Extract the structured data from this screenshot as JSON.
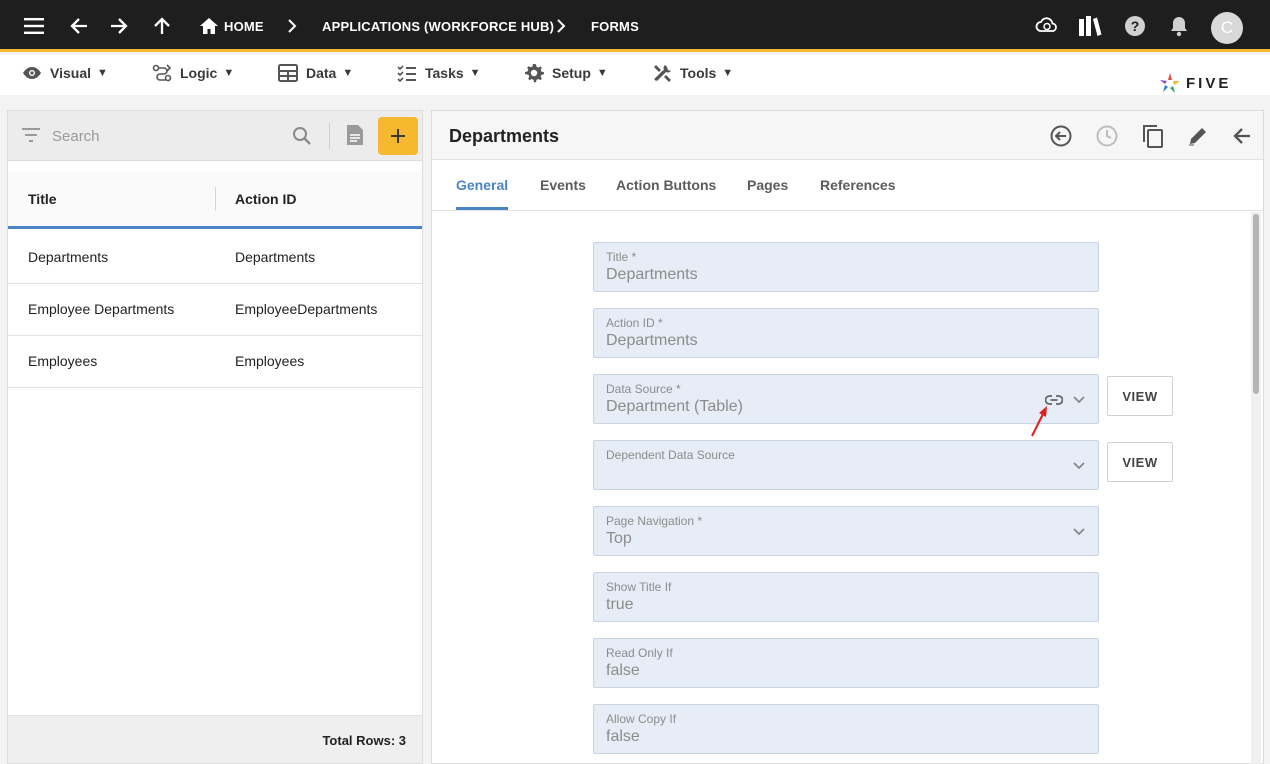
{
  "topbar": {
    "breadcrumbs": [
      "HOME",
      "APPLICATIONS (WORKFORCE HUB)",
      "FORMS"
    ],
    "avatar_letter": "C",
    "icons": [
      "menu-icon",
      "back-arrow-icon",
      "forward-arrow-icon",
      "up-arrow-icon",
      "home-icon",
      "cloud-sync-icon",
      "library-icon",
      "help-icon",
      "bell-icon"
    ]
  },
  "menubar": {
    "items": [
      {
        "label": "Visual",
        "icon": "eye-icon"
      },
      {
        "label": "Logic",
        "icon": "logic-icon"
      },
      {
        "label": "Data",
        "icon": "table-icon"
      },
      {
        "label": "Tasks",
        "icon": "tasks-icon"
      },
      {
        "label": "Setup",
        "icon": "gear-icon"
      },
      {
        "label": "Tools",
        "icon": "tools-icon"
      }
    ],
    "caret": "▼",
    "logo_text": "FIVE"
  },
  "left": {
    "search_placeholder": "Search",
    "add_label": "+",
    "columns": [
      "Title",
      "Action ID"
    ],
    "rows": [
      {
        "title": "Departments",
        "action_id": "Departments"
      },
      {
        "title": "Employee Departments",
        "action_id": "EmployeeDepartments"
      },
      {
        "title": "Employees",
        "action_id": "Employees"
      }
    ],
    "total_rows": "Total Rows: 3"
  },
  "right": {
    "title": "Departments",
    "tabs": [
      "General",
      "Events",
      "Action Buttons",
      "Pages",
      "References"
    ],
    "active_tab": "General",
    "fields": [
      {
        "label": "Title *",
        "value": "Departments"
      },
      {
        "label": "Action ID *",
        "value": "Departments"
      },
      {
        "label": "Data Source *",
        "value": "Department (Table)"
      },
      {
        "label": "Dependent Data Source",
        "value": ""
      },
      {
        "label": "Page Navigation *",
        "value": "Top"
      },
      {
        "label": "Show Title If",
        "value": "true"
      },
      {
        "label": "Read Only If",
        "value": "false"
      },
      {
        "label": "Allow Copy If",
        "value": "false"
      }
    ],
    "view_label": "VIEW"
  },
  "colors": {
    "topbar_bg": "#1e1e1e",
    "accent_yellow": "#f5b82e",
    "accent_blue": "#4a86c5",
    "field_bg": "#e6edf6",
    "annotation_red": "#e02020"
  }
}
